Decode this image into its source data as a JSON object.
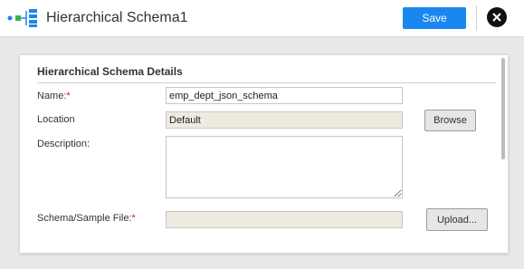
{
  "header": {
    "title": "Hierarchical Schema1",
    "save_label": "Save",
    "icon": "hierarchical-schema-icon",
    "close_icon": "close-icon"
  },
  "panel": {
    "title": "Hierarchical Schema Details",
    "fields": {
      "name": {
        "label": "Name:",
        "required_mark": "*",
        "value": "emp_dept_json_schema"
      },
      "location": {
        "label": "Location",
        "value": "Default",
        "button_label": "Browse"
      },
      "description": {
        "label": "Description:",
        "value": ""
      },
      "schema_file": {
        "label": "Schema/Sample File:",
        "required_mark": "*",
        "value": "",
        "button_label": "Upload..."
      }
    }
  },
  "colors": {
    "accent": "#1a86f0",
    "required": "#e02020",
    "readonly_bg": "#eeeae0"
  }
}
